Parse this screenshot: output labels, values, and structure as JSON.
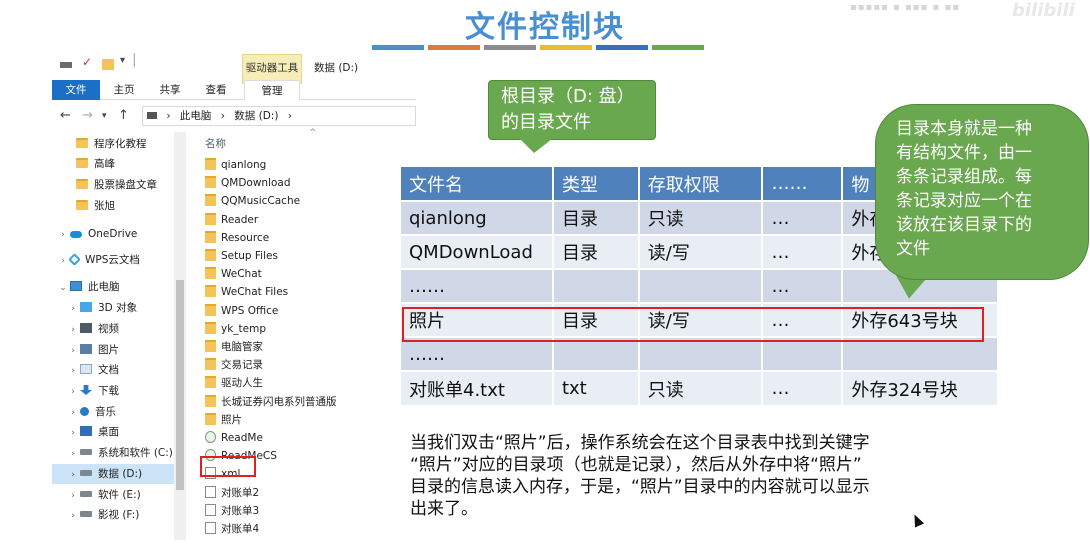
{
  "slide": {
    "title": "文件控制块",
    "bar_colors": [
      "#4a8fd0",
      "#e07a3a",
      "#8c8c8c",
      "#f2b73a",
      "#3a6fbf",
      "#6aa84f"
    ],
    "watermark": "bilibili"
  },
  "explorer": {
    "context_tab": "驱动器工具",
    "window_title": "数据 (D:)",
    "ribbon_tabs": [
      "文件",
      "主页",
      "共享",
      "查看",
      "管理"
    ],
    "address": [
      "此电脑",
      "数据 (D:)"
    ],
    "nav_items": [
      {
        "label": "程序化教程",
        "icon": "folder-icon"
      },
      {
        "label": "高峰",
        "icon": "folder-icon"
      },
      {
        "label": "股票操盘文章",
        "icon": "folder-icon"
      },
      {
        "label": "张旭",
        "icon": "folder-icon"
      },
      {
        "label": "OneDrive",
        "icon": "cloud-icon"
      },
      {
        "label": "WPS云文档",
        "icon": "wps-icon"
      },
      {
        "label": "此电脑",
        "icon": "pc-icon"
      },
      {
        "label": "3D 对象",
        "icon": "objects-3d-icon"
      },
      {
        "label": "视频",
        "icon": "video-icon"
      },
      {
        "label": "图片",
        "icon": "picture-icon"
      },
      {
        "label": "文档",
        "icon": "document-icon"
      },
      {
        "label": "下载",
        "icon": "download-icon"
      },
      {
        "label": "音乐",
        "icon": "music-icon"
      },
      {
        "label": "桌面",
        "icon": "desktop-icon"
      },
      {
        "label": "系统和软件 (C:)",
        "icon": "drive-icon"
      },
      {
        "label": "数据 (D:)",
        "icon": "drive-icon"
      },
      {
        "label": "软件 (E:)",
        "icon": "drive-icon"
      },
      {
        "label": "影视 (F:)",
        "icon": "drive-icon"
      }
    ],
    "column_name": "名称",
    "files": [
      {
        "name": "qianlong",
        "type": "folder"
      },
      {
        "name": "QMDownload",
        "type": "folder"
      },
      {
        "name": "QQMusicCache",
        "type": "folder"
      },
      {
        "name": "Reader",
        "type": "folder"
      },
      {
        "name": "Resource",
        "type": "folder"
      },
      {
        "name": "Setup Files",
        "type": "folder"
      },
      {
        "name": "WeChat",
        "type": "folder"
      },
      {
        "name": "WeChat Files",
        "type": "folder"
      },
      {
        "name": "WPS Office",
        "type": "folder"
      },
      {
        "name": "yk_temp",
        "type": "folder"
      },
      {
        "name": "电脑管家",
        "type": "folder"
      },
      {
        "name": "交易记录",
        "type": "folder"
      },
      {
        "name": "驱动人生",
        "type": "folder"
      },
      {
        "name": "长城证券闪电系列普通版",
        "type": "folder"
      },
      {
        "name": "照片",
        "type": "folder"
      },
      {
        "name": "ReadMe",
        "type": "readme"
      },
      {
        "name": "ReadMeCS",
        "type": "readme"
      },
      {
        "name": "xml",
        "type": "file"
      },
      {
        "name": "对账单2",
        "type": "file"
      },
      {
        "name": "对账单3",
        "type": "file"
      },
      {
        "name": "对账单4",
        "type": "file"
      }
    ]
  },
  "callouts": {
    "root": "根目录（D: 盘）的目录文件",
    "root_lines": [
      "根目录（D: 盘）",
      "的目录文件"
    ],
    "explain_lines": [
      "目录本身就是一种",
      "有结构文件，由一",
      "条条记录组成。每",
      "条记录对应一个在",
      "该放在该目录下的",
      "文件"
    ]
  },
  "table": {
    "headers": [
      "文件名",
      "类型",
      "存取权限",
      "……",
      "物"
    ],
    "rows": [
      [
        "qianlong",
        "目录",
        "只读",
        "…",
        "外存"
      ],
      [
        "QMDownLoad",
        "目录",
        "读/写",
        "…",
        "外存"
      ],
      [
        "……",
        "",
        "",
        "…",
        ""
      ],
      [
        "照片",
        "目录",
        "读/写",
        "…",
        "外存643号块"
      ],
      [
        "……",
        "",
        "",
        "",
        ""
      ],
      [
        "对账单4.txt",
        "txt",
        "只读",
        "…",
        "外存324号块"
      ]
    ]
  },
  "paragraph_lines": [
    "当我们双击“照片”后，操作系统会在这个目录表中找到关键字",
    "“照片”对应的目录项（也就是记录），然后从外存中将“照片”",
    "目录的信息读入内存，于是，“照片”目录中的内容就可以显示",
    "出来了。"
  ]
}
